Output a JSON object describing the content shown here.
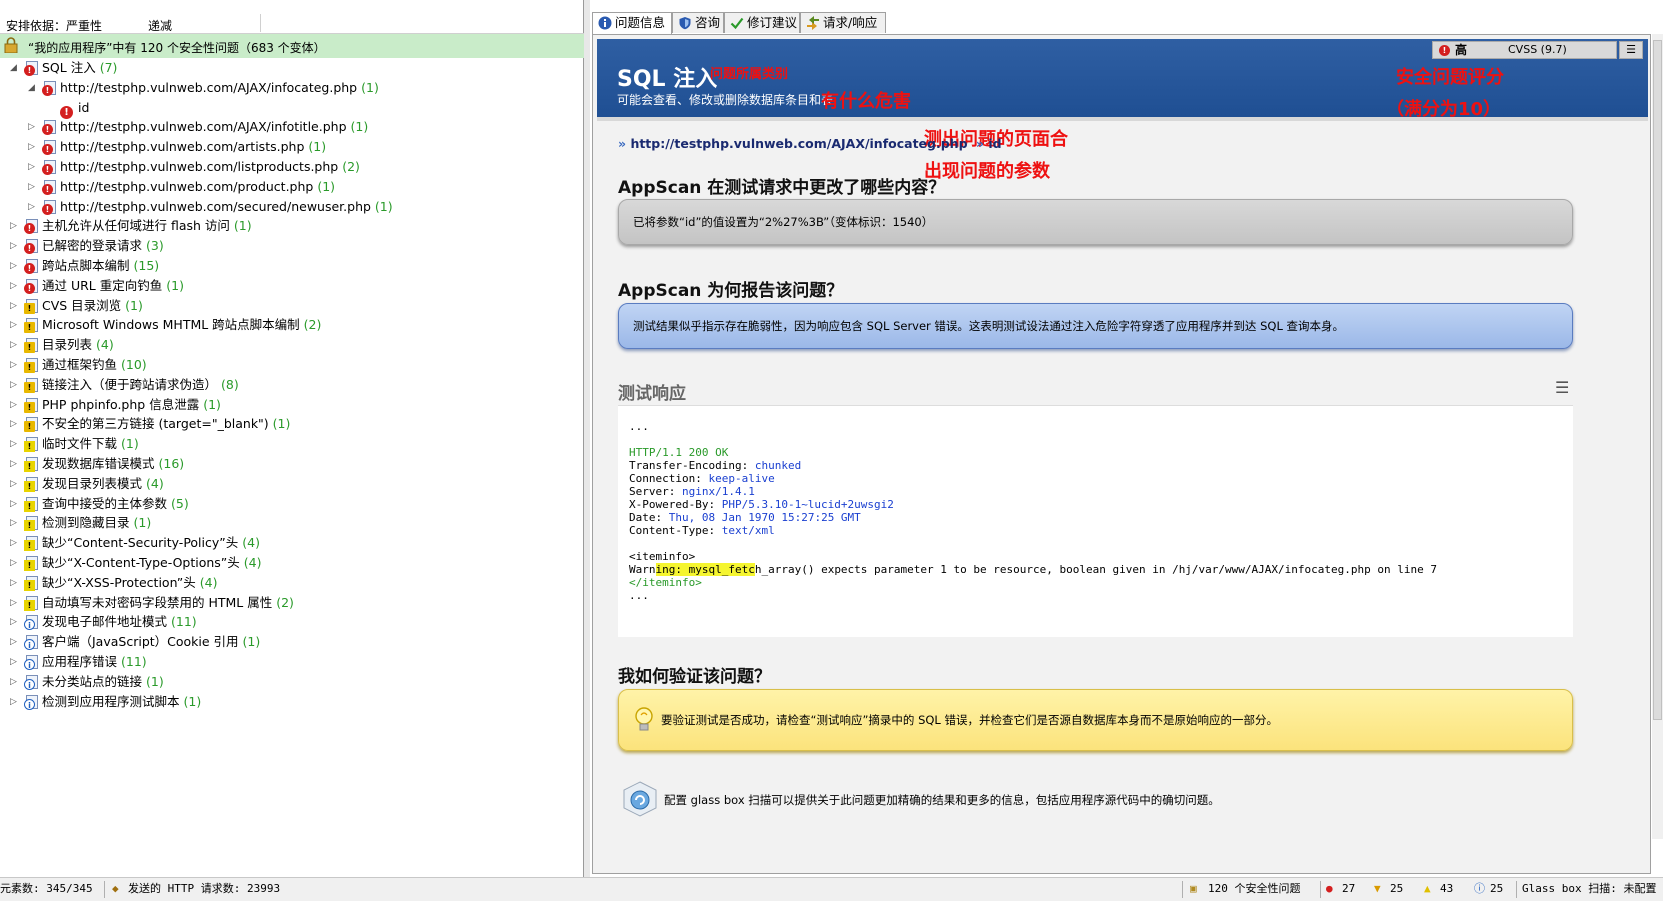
{
  "left_panel": {
    "sort_by_label": "安排依据：严重性",
    "sort_dir_label": "递减",
    "summary": "“我的应用程序”中有 120 个安全性问题（683 个变体）",
    "tree": [
      {
        "level": 0,
        "expanded": true,
        "sev": "high",
        "label": "SQL 注入",
        "count": "(7)"
      },
      {
        "level": 1,
        "expanded": true,
        "sev": "high",
        "label": "http://testphp.vulnweb.com/AJAX/infocateg.php",
        "count": "(1)"
      },
      {
        "level": 2,
        "expanded": null,
        "sev": "high-dot",
        "label": "id",
        "count": ""
      },
      {
        "level": 1,
        "expanded": false,
        "sev": "high",
        "label": "http://testphp.vulnweb.com/AJAX/infotitle.php",
        "count": "(1)"
      },
      {
        "level": 1,
        "expanded": false,
        "sev": "high",
        "label": "http://testphp.vulnweb.com/artists.php",
        "count": "(1)"
      },
      {
        "level": 1,
        "expanded": false,
        "sev": "high",
        "label": "http://testphp.vulnweb.com/listproducts.php",
        "count": "(2)"
      },
      {
        "level": 1,
        "expanded": false,
        "sev": "high",
        "label": "http://testphp.vulnweb.com/product.php",
        "count": "(1)"
      },
      {
        "level": 1,
        "expanded": false,
        "sev": "high",
        "label": "http://testphp.vulnweb.com/secured/newuser.php",
        "count": "(1)"
      },
      {
        "level": 0,
        "expanded": false,
        "sev": "high",
        "label": "主机允许从任何域进行 flash 访问",
        "count": "(1)"
      },
      {
        "level": 0,
        "expanded": false,
        "sev": "high",
        "label": "已解密的登录请求",
        "count": "(3)"
      },
      {
        "level": 0,
        "expanded": false,
        "sev": "high",
        "label": "跨站点脚本编制",
        "count": "(15)"
      },
      {
        "level": 0,
        "expanded": false,
        "sev": "high",
        "label": "通过 URL 重定向钓鱼",
        "count": "(1)"
      },
      {
        "level": 0,
        "expanded": false,
        "sev": "med",
        "label": "CVS 目录浏览",
        "count": "(1)"
      },
      {
        "level": 0,
        "expanded": false,
        "sev": "med",
        "label": "Microsoft Windows MHTML 跨站点脚本编制",
        "count": "(2)"
      },
      {
        "level": 0,
        "expanded": false,
        "sev": "med",
        "label": "目录列表",
        "count": "(4)"
      },
      {
        "level": 0,
        "expanded": false,
        "sev": "med",
        "label": "通过框架钓鱼",
        "count": "(10)"
      },
      {
        "level": 0,
        "expanded": false,
        "sev": "med",
        "label": "链接注入（便于跨站请求伪造）",
        "count": "(8)"
      },
      {
        "level": 0,
        "expanded": false,
        "sev": "med",
        "label": "PHP phpinfo.php 信息泄露",
        "count": "(1)"
      },
      {
        "level": 0,
        "expanded": false,
        "sev": "med",
        "label": "不安全的第三方链接 (target=\"_blank\")",
        "count": "(1)"
      },
      {
        "level": 0,
        "expanded": false,
        "sev": "low",
        "label": "临时文件下载",
        "count": "(1)"
      },
      {
        "level": 0,
        "expanded": false,
        "sev": "low",
        "label": "发现数据库错误模式",
        "count": "(16)"
      },
      {
        "level": 0,
        "expanded": false,
        "sev": "low",
        "label": "发现目录列表模式",
        "count": "(4)"
      },
      {
        "level": 0,
        "expanded": false,
        "sev": "low",
        "label": "查询中接受的主体参数",
        "count": "(5)"
      },
      {
        "level": 0,
        "expanded": false,
        "sev": "low",
        "label": "检测到隐藏目录",
        "count": "(1)"
      },
      {
        "level": 0,
        "expanded": false,
        "sev": "low",
        "label": "缺少“Content-Security-Policy”头",
        "count": "(4)"
      },
      {
        "level": 0,
        "expanded": false,
        "sev": "low",
        "label": "缺少“X-Content-Type-Options”头",
        "count": "(4)"
      },
      {
        "level": 0,
        "expanded": false,
        "sev": "low",
        "label": "缺少“X-XSS-Protection”头",
        "count": "(4)"
      },
      {
        "level": 0,
        "expanded": false,
        "sev": "low",
        "label": "自动填写未对密码字段禁用的 HTML 属性",
        "count": "(2)"
      },
      {
        "level": 0,
        "expanded": false,
        "sev": "info",
        "label": "发现电子邮件地址模式",
        "count": "(11)"
      },
      {
        "level": 0,
        "expanded": false,
        "sev": "info",
        "label": "客户端（JavaScript）Cookie 引用",
        "count": "(1)"
      },
      {
        "level": 0,
        "expanded": false,
        "sev": "info",
        "label": "应用程序错误",
        "count": "(11)"
      },
      {
        "level": 0,
        "expanded": false,
        "sev": "info",
        "label": "未分类站点的链接",
        "count": "(1)"
      },
      {
        "level": 0,
        "expanded": false,
        "sev": "info",
        "label": "检测到应用程序测试脚本",
        "count": "(1)"
      }
    ]
  },
  "tabs": [
    {
      "label": "问题信息",
      "icon": "info-icon",
      "active": true
    },
    {
      "label": "咨询",
      "icon": "shield-icon",
      "active": false
    },
    {
      "label": "修订建议",
      "icon": "checkmark-icon",
      "active": false
    },
    {
      "label": "请求/响应",
      "icon": "arrows-icon",
      "active": false
    }
  ],
  "banner": {
    "title": "SQL 注入",
    "subtitle": "可能会查看、修改或删除数据库条目和表",
    "severity_label": "高",
    "cvss_label": "CVSS  (9.7)",
    "menu_glyph": "☰"
  },
  "annotations": {
    "category": "问题所属类别",
    "harm": "有什么危害",
    "score_line1": "安全问题评分",
    "score_line2": "（满分为10）",
    "page_line1": "测出问题的页面合",
    "page_line2": "出现问题的参数"
  },
  "location": {
    "url": "http://testphp.vulnweb.com/AJAX/infocateg.php",
    "param": "id"
  },
  "sections": {
    "changed_heading": "AppScan 在测试请求中更改了哪些内容？",
    "changed_text": "已将参数“id”的值设置为“2%27%3B”（变体标识：1540）",
    "why_heading": "AppScan 为何报告该问题？",
    "why_text": "测试结果似乎指示存在脆弱性，因为响应包含 SQL Server 错误。这表明测试设法通过注入危险字符穿透了应用程序并到达 SQL 查询本身。",
    "response_heading": "测试响应",
    "verify_heading": "我如何验证该问题？",
    "verify_text": "要验证测试是否成功，请检查“测试响应”摘录中的 SQL 错误，并检查它们是否源自数据库本身而不是原始响应的一部分。",
    "glassbox_text": "配置 glass box 扫描可以提供关于此问题更加精确的结果和更多的信息，包括应用程序源代码中的确切问题。"
  },
  "response": {
    "ellipsis": "...",
    "status_line": "HTTP/1.1 200 OK",
    "headers": [
      {
        "name": "Transfer-Encoding: ",
        "value": "chunked"
      },
      {
        "name": "Connection: ",
        "value": "keep-alive"
      },
      {
        "name": "Server: ",
        "value": "nginx/1.4.1"
      },
      {
        "name": "X-Powered-By: ",
        "value": "PHP/5.3.10-1~lucid+2uwsgi2"
      },
      {
        "name": "Date: ",
        "value": "Thu, 08 Jan 1970 15:27:25 GMT"
      },
      {
        "name": "Content-Type: ",
        "value": "text/xml"
      }
    ],
    "open_tag": "<iteminfo>",
    "warn_pre": "Warn",
    "warn_hl": "ing: mysql_fetc",
    "warn_post": "h_array() expects parameter 1 to be resource, boolean given in /hj/var/www/AJAX/infocateg.php on line 7",
    "close_tag": "</iteminfo>",
    "end_ellipsis": "..."
  },
  "status_bar": {
    "urls": "元素数: 345/345",
    "requests": "发送的 HTTP 请求数: 23993",
    "issues": "120 个安全性问题",
    "high": "27",
    "medium": "25",
    "low": "43",
    "info": "25",
    "glassbox": "Glass box 扫描: 未配置"
  }
}
